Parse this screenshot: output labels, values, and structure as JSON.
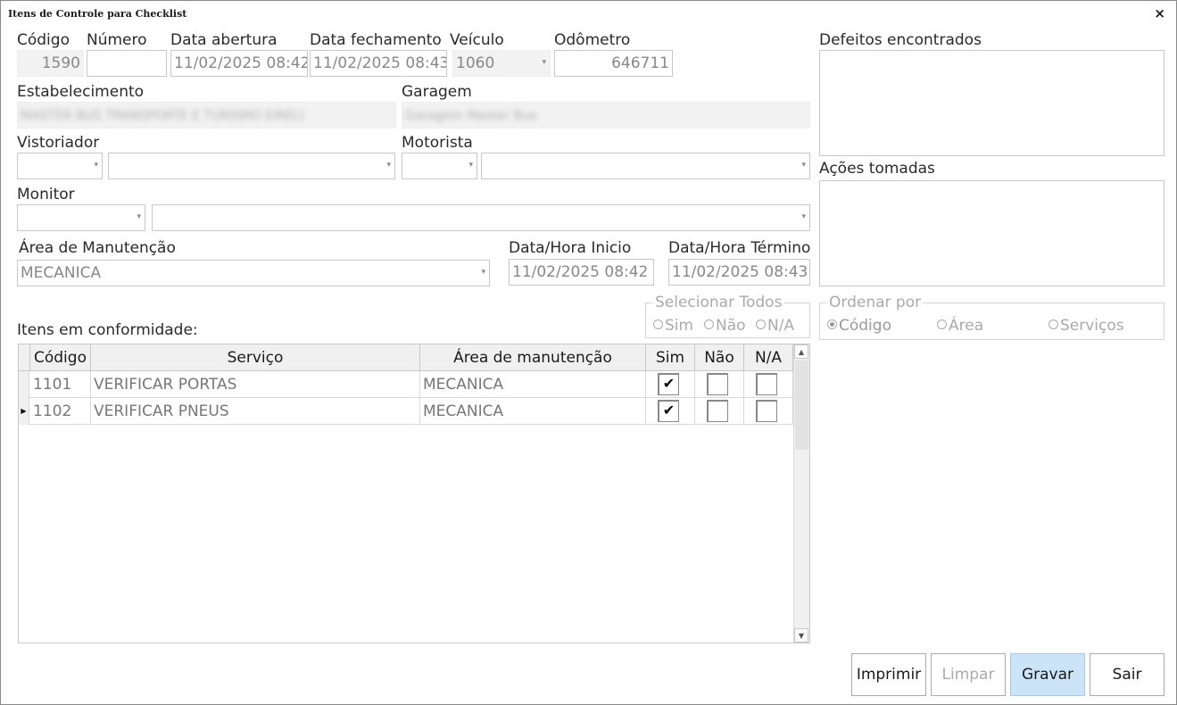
{
  "window": {
    "title": "Itens de Controle para Checklist",
    "close_glyph": "×"
  },
  "header": {
    "codigo": {
      "label": "Código",
      "value": "1590"
    },
    "numero": {
      "label": "Número",
      "value": ""
    },
    "data_abertura": {
      "label": "Data abertura",
      "value": "11/02/2025 08:42"
    },
    "data_fechamento": {
      "label": "Data fechamento",
      "value": "11/02/2025 08:43"
    },
    "veiculo": {
      "label": "Veículo",
      "value": "1060"
    },
    "odometro": {
      "label": "Odômetro",
      "value": "646711"
    }
  },
  "estabelecimento": {
    "label": "Estabelecimento",
    "value": "MASTER BUS TRANSPORTE E TURISMO EIRELI"
  },
  "garagem": {
    "label": "Garagem",
    "value": "Garagem Master Bus"
  },
  "vistoriador": {
    "label": "Vistoriador",
    "code": "",
    "name": ""
  },
  "motorista": {
    "label": "Motorista",
    "code": "",
    "name": ""
  },
  "monitor": {
    "label": "Monitor",
    "code": "",
    "name": ""
  },
  "area_manutencao": {
    "label": "Área de Manutenção",
    "value": "MECANICA"
  },
  "data_hora_inicio": {
    "label": "Data/Hora Inicio",
    "value": "11/02/2025 08:42"
  },
  "data_hora_termino": {
    "label": "Data/Hora Término",
    "value": "11/02/2025 08:43"
  },
  "defeitos": {
    "label": "Defeitos encontrados",
    "value": ""
  },
  "acoes": {
    "label": "Ações tomadas",
    "value": ""
  },
  "selecionar_todos": {
    "title": "Selecionar Todos",
    "options": [
      "Sim",
      "Não",
      "N/A"
    ]
  },
  "ordenar_por": {
    "title": "Ordenar por",
    "options": [
      "Código",
      "Área",
      "Serviços"
    ],
    "selected": "Código"
  },
  "itens": {
    "label": "Itens em conformidade:",
    "columns": [
      "Código",
      "Serviço",
      "Área de manutenção",
      "Sim",
      "Não",
      "N/A"
    ],
    "rows": [
      {
        "codigo": "1101",
        "servico": "VERIFICAR PORTAS",
        "area": "MECANICA",
        "sim": true,
        "nao": false,
        "na": false
      },
      {
        "codigo": "1102",
        "servico": "VERIFICAR PNEUS",
        "area": "MECANICA",
        "sim": true,
        "nao": false,
        "na": false
      }
    ]
  },
  "buttons": {
    "imprimir": "Imprimir",
    "limpar": "Limpar",
    "gravar": "Gravar",
    "sair": "Sair"
  },
  "icons": {
    "dropdown": "chevron-down-icon",
    "checkmark": "✔",
    "row_pointer": "▶",
    "scroll_up": "▲",
    "scroll_down": "▼"
  }
}
